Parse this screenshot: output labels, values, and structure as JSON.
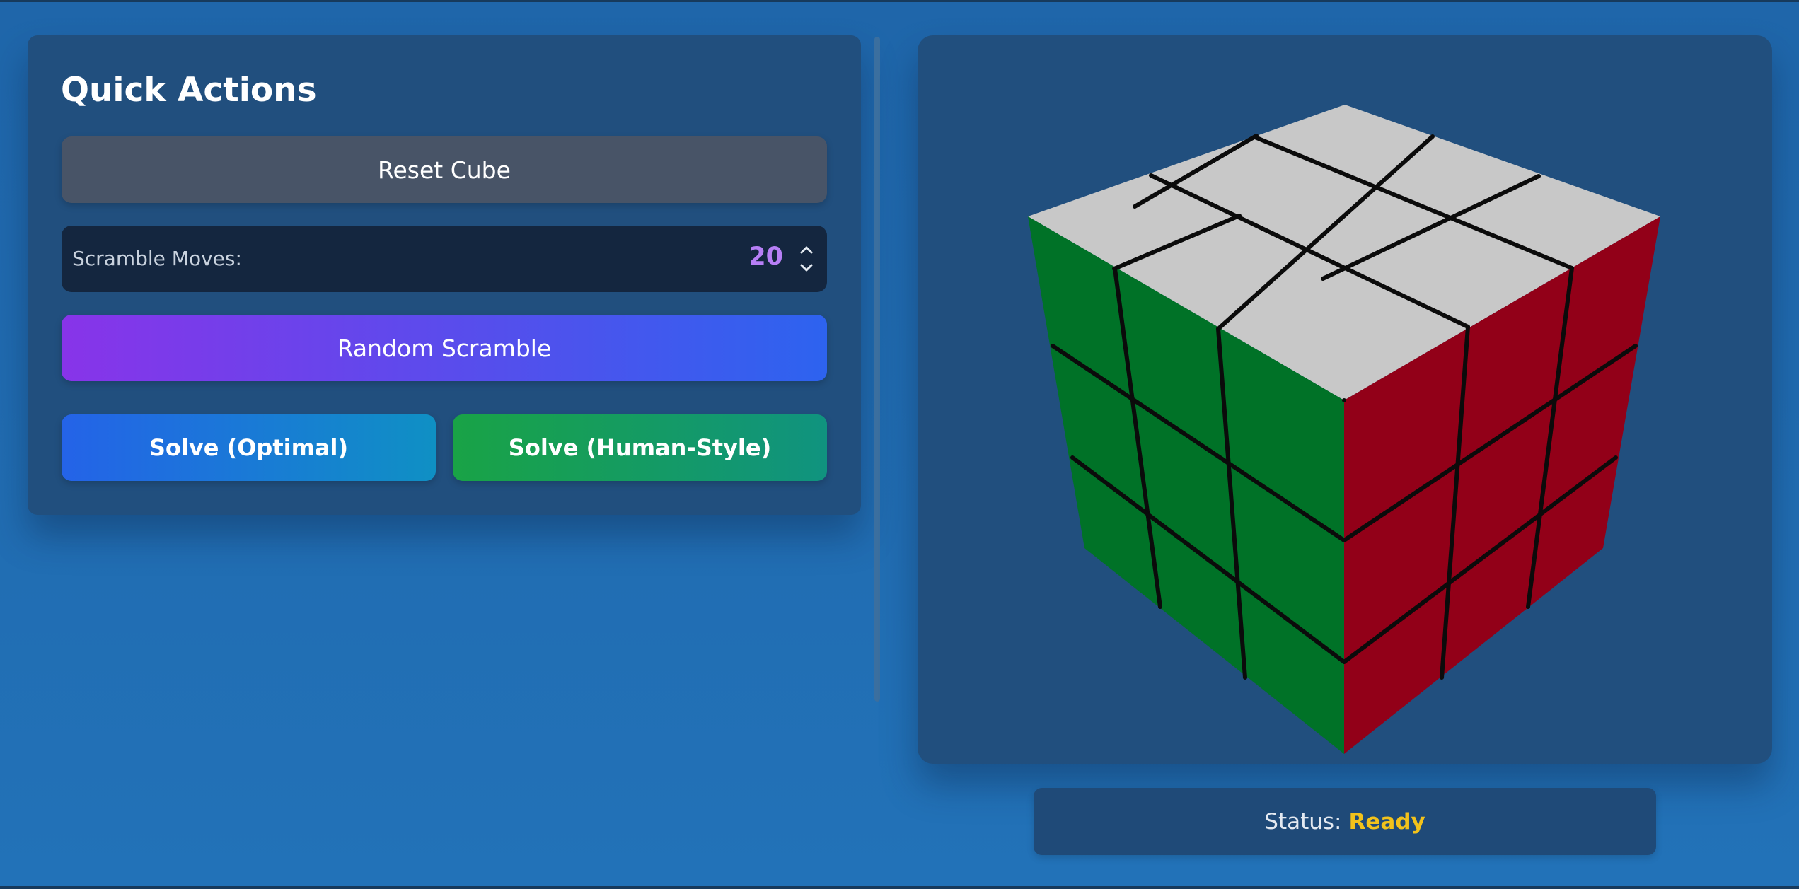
{
  "quick_actions": {
    "title": "Quick Actions",
    "reset_label": "Reset Cube",
    "scramble_label": "Scramble Moves:",
    "scramble_value": "20",
    "random_label": "Random Scramble",
    "solve_optimal_label": "Solve (Optimal)",
    "solve_human_label": "Solve (Human-Style)"
  },
  "status": {
    "label": "Status:",
    "value": "Ready"
  },
  "cube": {
    "size": "3x3",
    "faces": {
      "top": "#c8c8c8",
      "left": "#007227",
      "right": "#920018"
    }
  },
  "colors": {
    "background": "#2272b8",
    "panel": "#214f7e",
    "status_ready": "#f2c21b",
    "scramble_value": "#b77ff6"
  },
  "icons": {
    "stepper": "chevron-up-down-icon"
  }
}
